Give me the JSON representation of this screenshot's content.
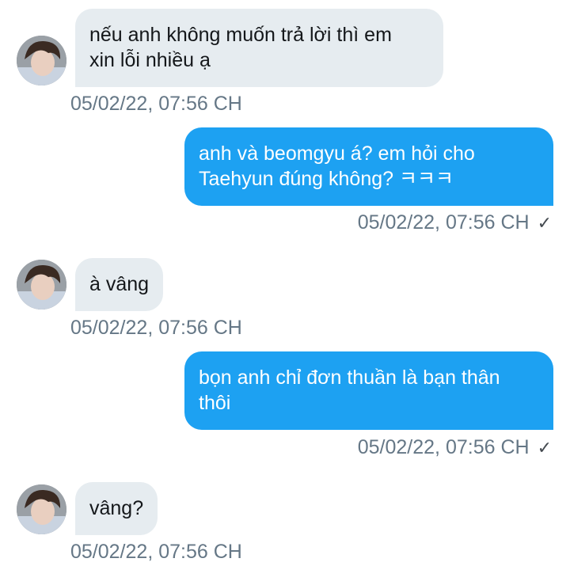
{
  "messages": [
    {
      "direction": "in",
      "text": "nếu anh không muốn trả lời thì em\nxin lỗi nhiều ạ",
      "time": "05/02/22, 07:56 CH"
    },
    {
      "direction": "out",
      "text": "anh và beomgyu á? em hỏi cho\nTaehyun đúng không? ㅋㅋㅋ",
      "time": "05/02/22, 07:56 CH",
      "status": "✓"
    },
    {
      "direction": "in",
      "text": "à vâng",
      "time": "05/02/22, 07:56 CH"
    },
    {
      "direction": "out",
      "text": "bọn anh chỉ đơn thuần là bạn thân\nthôi",
      "time": "05/02/22, 07:56 CH",
      "status": "✓"
    },
    {
      "direction": "in",
      "text": "vâng?",
      "time": "05/02/22, 07:56 CH"
    }
  ],
  "colors": {
    "incoming_bubble": "#e6ecf0",
    "outgoing_bubble": "#1da1f2",
    "timestamp": "#657786"
  },
  "icons": {
    "avatar": "contact-avatar-photo",
    "read_receipt": "checkmark-icon"
  }
}
